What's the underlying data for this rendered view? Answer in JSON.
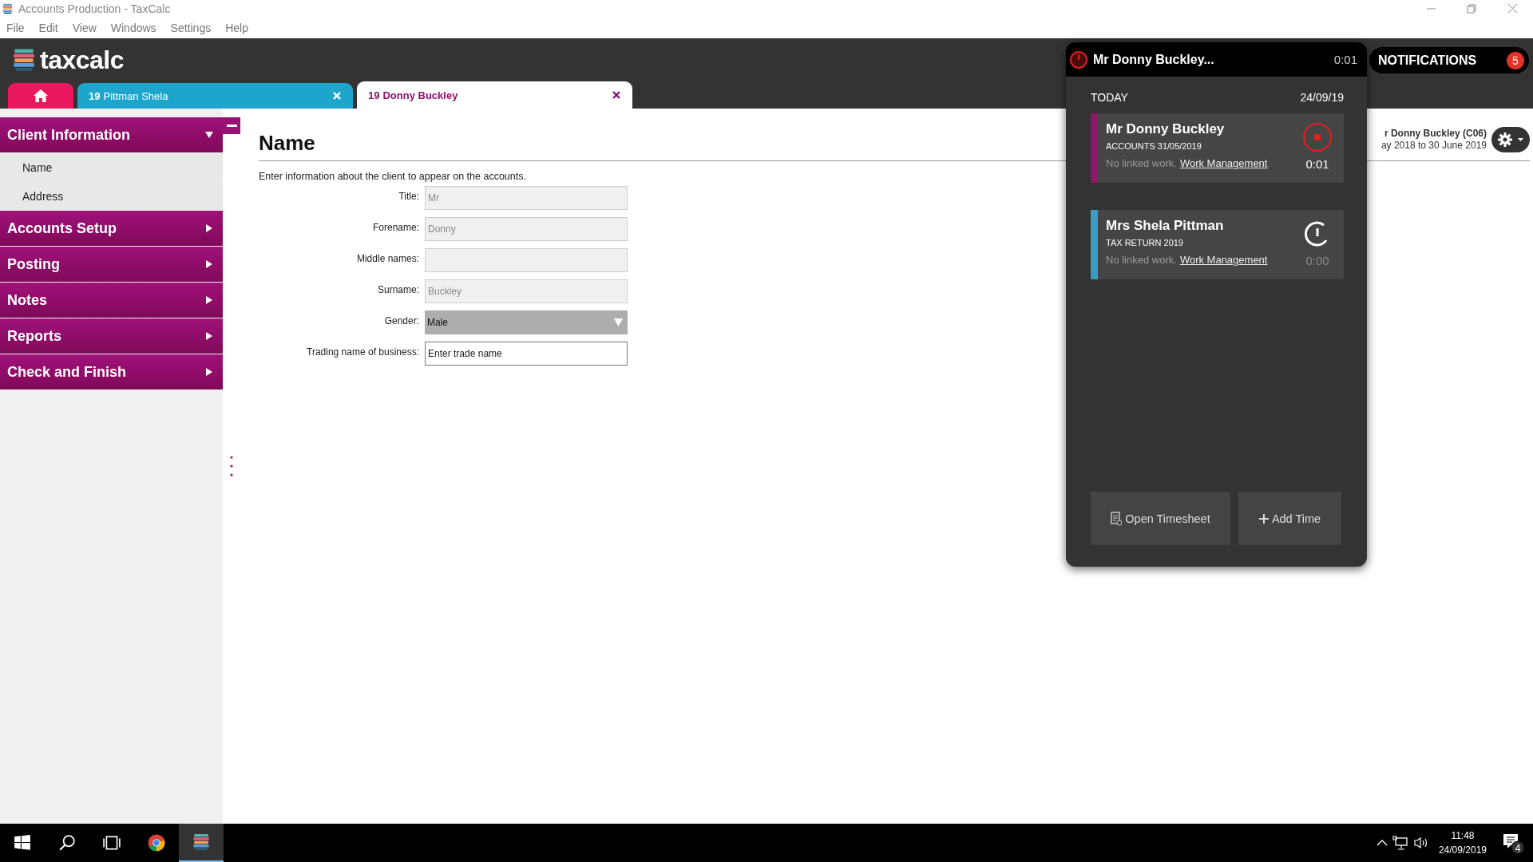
{
  "window": {
    "title": "Accounts Production - TaxCalc"
  },
  "menu": [
    "File",
    "Edit",
    "View",
    "Windows",
    "Settings",
    "Help"
  ],
  "logo": {
    "text": "taxcalc"
  },
  "tabs": [
    {
      "kind": "home",
      "selected": false
    },
    {
      "kind": "client",
      "number": "19",
      "label": "Pittman Shela",
      "selected": false
    },
    {
      "kind": "client",
      "number": "19",
      "label": "Donny Buckley",
      "selected": true
    }
  ],
  "sidebar": {
    "sections": [
      {
        "label": "Client Information",
        "expanded": true,
        "children": [
          {
            "label": "Name"
          },
          {
            "label": "Address"
          }
        ]
      },
      {
        "label": "Accounts Setup",
        "expanded": false
      },
      {
        "label": "Posting",
        "expanded": false
      },
      {
        "label": "Notes",
        "expanded": false
      },
      {
        "label": "Reports",
        "expanded": false
      },
      {
        "label": "Check and Finish",
        "expanded": false
      }
    ]
  },
  "page": {
    "heading": "Name",
    "intro": "Enter information about the client to appear on the accounts.",
    "fields": [
      {
        "label": "Title:",
        "kind": "text",
        "value": "Mr",
        "disabled": true
      },
      {
        "label": "Forename:",
        "kind": "text",
        "value": "Donny",
        "disabled": true
      },
      {
        "label": "Middle names:",
        "kind": "text",
        "disabled": true
      },
      {
        "label": "Surname:",
        "kind": "text",
        "value": "Buckley",
        "disabled": true
      },
      {
        "label": "Gender:",
        "kind": "select",
        "value": "Male",
        "disabled": true
      },
      {
        "label": "Trading name of business:",
        "kind": "text",
        "placeholder": "Enter trade name",
        "disabled": false
      }
    ]
  },
  "client_info": {
    "name": "r Donny Buckley (C06)",
    "period": "ay 2018 to 30 June 2019"
  },
  "notifications": {
    "label": "NOTIFICATIONS",
    "count": "5"
  },
  "timer_popup": {
    "title": "Mr Donny Buckley...",
    "elapsed": "0:01",
    "day_label": "TODAY",
    "date": "24/09/19",
    "entries": [
      {
        "client": "Mr Donny Buckley",
        "job": "ACCOUNTS 31/05/2019",
        "note": "No linked work.",
        "link": "Work Management",
        "time": "0:01",
        "running": true,
        "color": "#8c1a6a"
      },
      {
        "client": "Mrs Shela Pittman",
        "job": "TAX RETURN 2019",
        "note": "No linked work.",
        "link": "Work Management",
        "time": "0:00",
        "running": false,
        "color": "#3b9cc2"
      }
    ],
    "buttons": [
      {
        "kind": "timesheet",
        "label": "Open Timesheet"
      },
      {
        "kind": "add",
        "label": "Add Time"
      }
    ]
  },
  "taskbar": {
    "apps": [
      {
        "kind": "start",
        "selected": false
      },
      {
        "kind": "search",
        "selected": false
      },
      {
        "kind": "taskview",
        "selected": false
      },
      {
        "kind": "browser",
        "selected": false
      },
      {
        "kind": "app",
        "selected": true
      }
    ],
    "time": "11:48",
    "date": "24/09/2019",
    "notification_count": "4"
  }
}
